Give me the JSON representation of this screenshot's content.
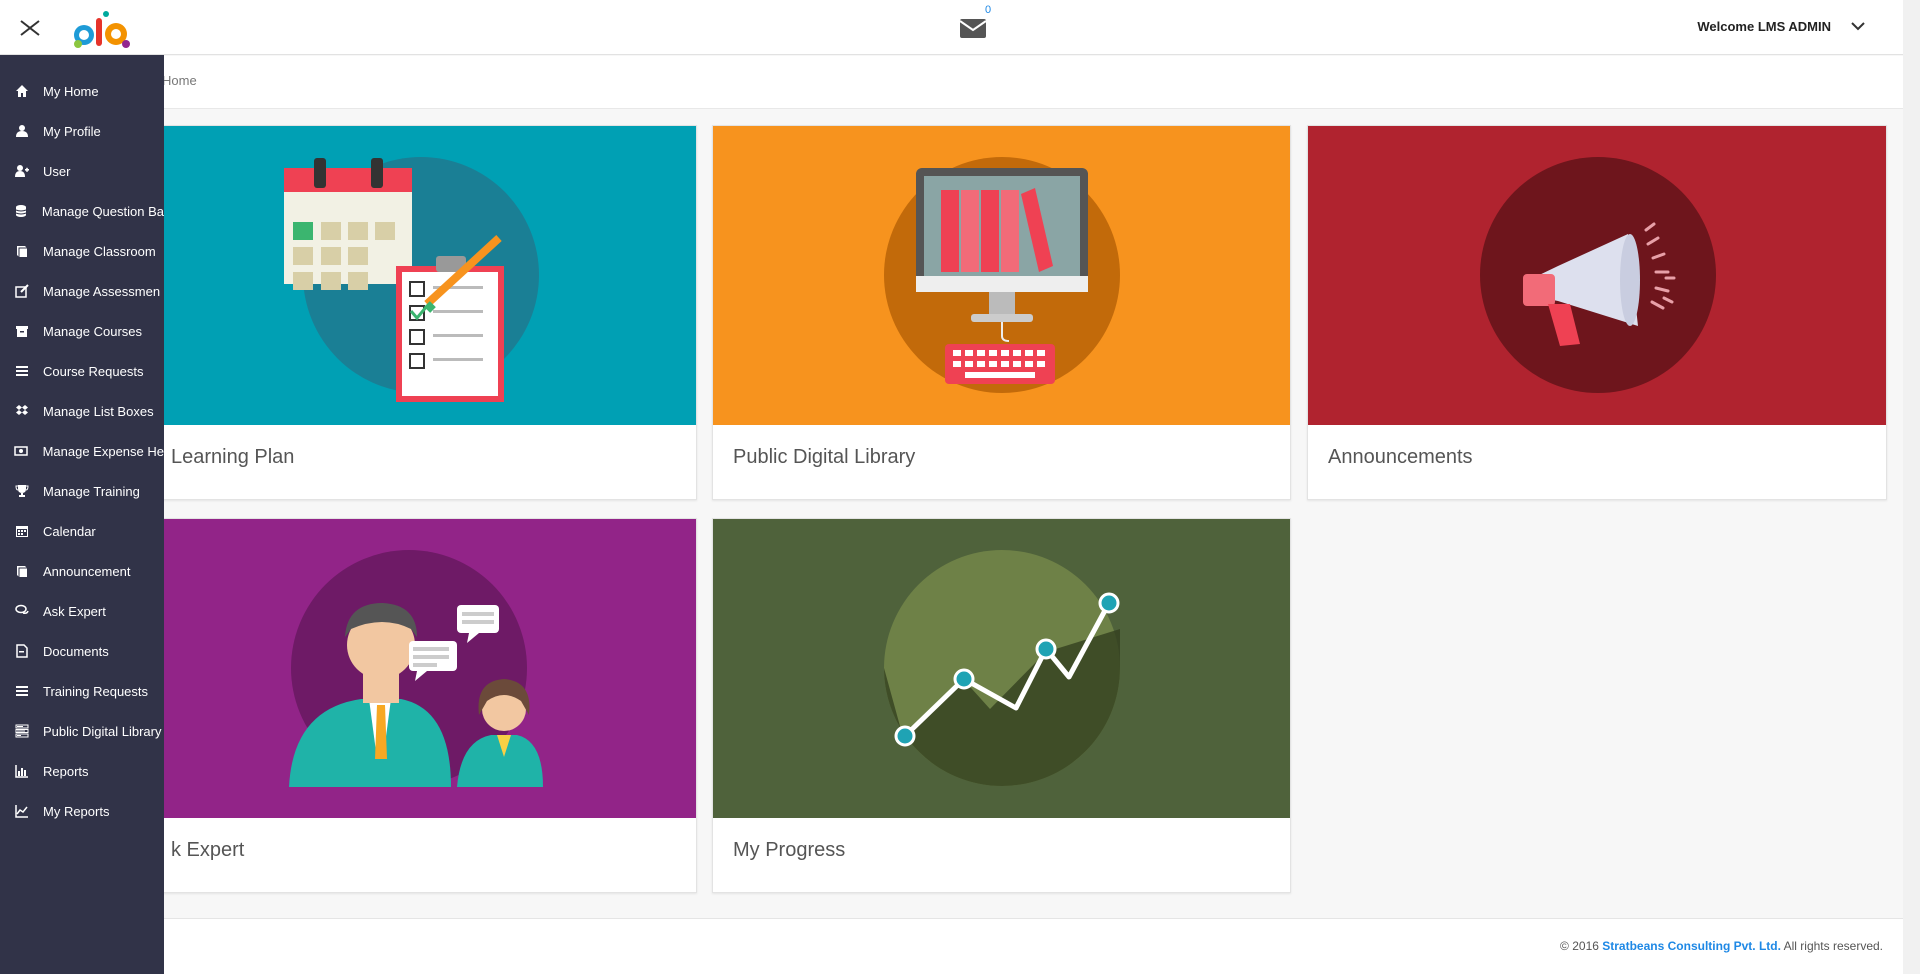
{
  "header": {
    "mail_count": "0",
    "welcome": "Welcome LMS ADMIN"
  },
  "breadcrumb": {
    "text": "Home"
  },
  "sidebar": {
    "items": [
      {
        "label": "My Home",
        "icon": "home-icon"
      },
      {
        "label": "My Profile",
        "icon": "user-icon"
      },
      {
        "label": "User",
        "icon": "user-plus-icon"
      },
      {
        "label": "Manage Question Ba",
        "icon": "database-icon"
      },
      {
        "label": "Manage Classroom",
        "icon": "book-icon"
      },
      {
        "label": "Manage Assessmen",
        "icon": "edit-icon"
      },
      {
        "label": "Manage Courses",
        "icon": "archive-icon"
      },
      {
        "label": "Course Requests",
        "icon": "list-icon"
      },
      {
        "label": "Manage List Boxes",
        "icon": "dropbox-icon"
      },
      {
        "label": "Manage Expense He",
        "icon": "money-icon"
      },
      {
        "label": "Manage Training",
        "icon": "trophy-icon"
      },
      {
        "label": "Calendar",
        "icon": "calendar-icon"
      },
      {
        "label": "Announcement",
        "icon": "book-icon"
      },
      {
        "label": "Ask Expert",
        "icon": "comments-icon"
      },
      {
        "label": "Documents",
        "icon": "document-icon"
      },
      {
        "label": "Training Requests",
        "icon": "list-icon"
      },
      {
        "label": "Public Digital Library",
        "icon": "tasks-icon"
      },
      {
        "label": "Reports",
        "icon": "bar-chart-icon"
      },
      {
        "label": "My Reports",
        "icon": "line-chart-icon"
      }
    ]
  },
  "cards": [
    {
      "label": "Learning Plan",
      "color": "#00a0b4"
    },
    {
      "label": "Public Digital Library",
      "color": "#f7931e"
    },
    {
      "label": "Announcements",
      "color": "#b0232f"
    },
    {
      "label": "k Expert",
      "color": "#922488"
    },
    {
      "label": "My Progress",
      "color": "#4f623b"
    }
  ],
  "footer": {
    "copyright": "© 2016",
    "company": "Stratbeans Consulting Pvt. Ltd.",
    "rights": "All rights reserved."
  }
}
